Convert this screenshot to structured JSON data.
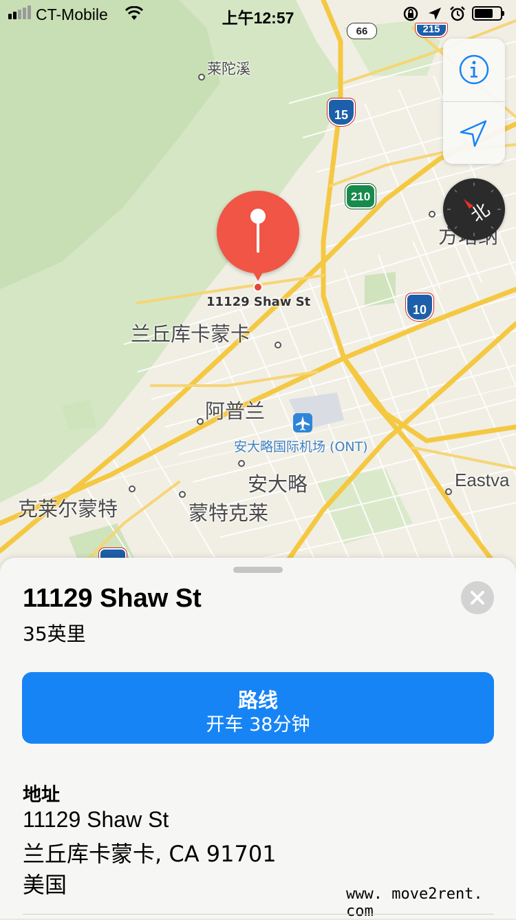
{
  "status_bar": {
    "carrier": "CT-Mobile",
    "time": "上午12:57",
    "icons": [
      "signal-icon",
      "wifi-icon",
      "orientation-lock-icon",
      "location-arrow-icon",
      "alarm-icon",
      "battery-icon"
    ]
  },
  "map": {
    "labels": {
      "laituoxi": "莱陀溪",
      "rancho": "兰丘库卡蒙卡",
      "upland": "阿普兰",
      "airport": "安大略国际机场 (ONT)",
      "ontario": "安大略",
      "montclair": "蒙特克莱",
      "claremont": "克莱尔蒙特",
      "fontana": "方塔纳",
      "eastvale": "Eastva",
      "pin_label": "11129 Shaw St"
    },
    "shields": {
      "i15": "15",
      "i10": "10",
      "sr210": "210",
      "sr66": "66",
      "i215": "215"
    },
    "compass_label": "北",
    "colors": {
      "road_major": "#f5c842",
      "road_minor": "#ffffff",
      "park": "#cfe3bc",
      "land": "#f1eee4",
      "pin": "#f05545"
    }
  },
  "controls": {
    "info_icon": "info-icon",
    "locate_icon": "location-arrow-icon"
  },
  "sheet": {
    "title": "11129 Shaw St",
    "distance": "35英里",
    "route_button": {
      "label": "路线",
      "sublabel": "开车 38分钟",
      "color": "#1784f5"
    },
    "address_heading": "地址",
    "address_lines": [
      "11129 Shaw St",
      "兰丘库卡蒙卡, CA  91701",
      "美国"
    ],
    "watermark": "www. move2rent. com"
  }
}
